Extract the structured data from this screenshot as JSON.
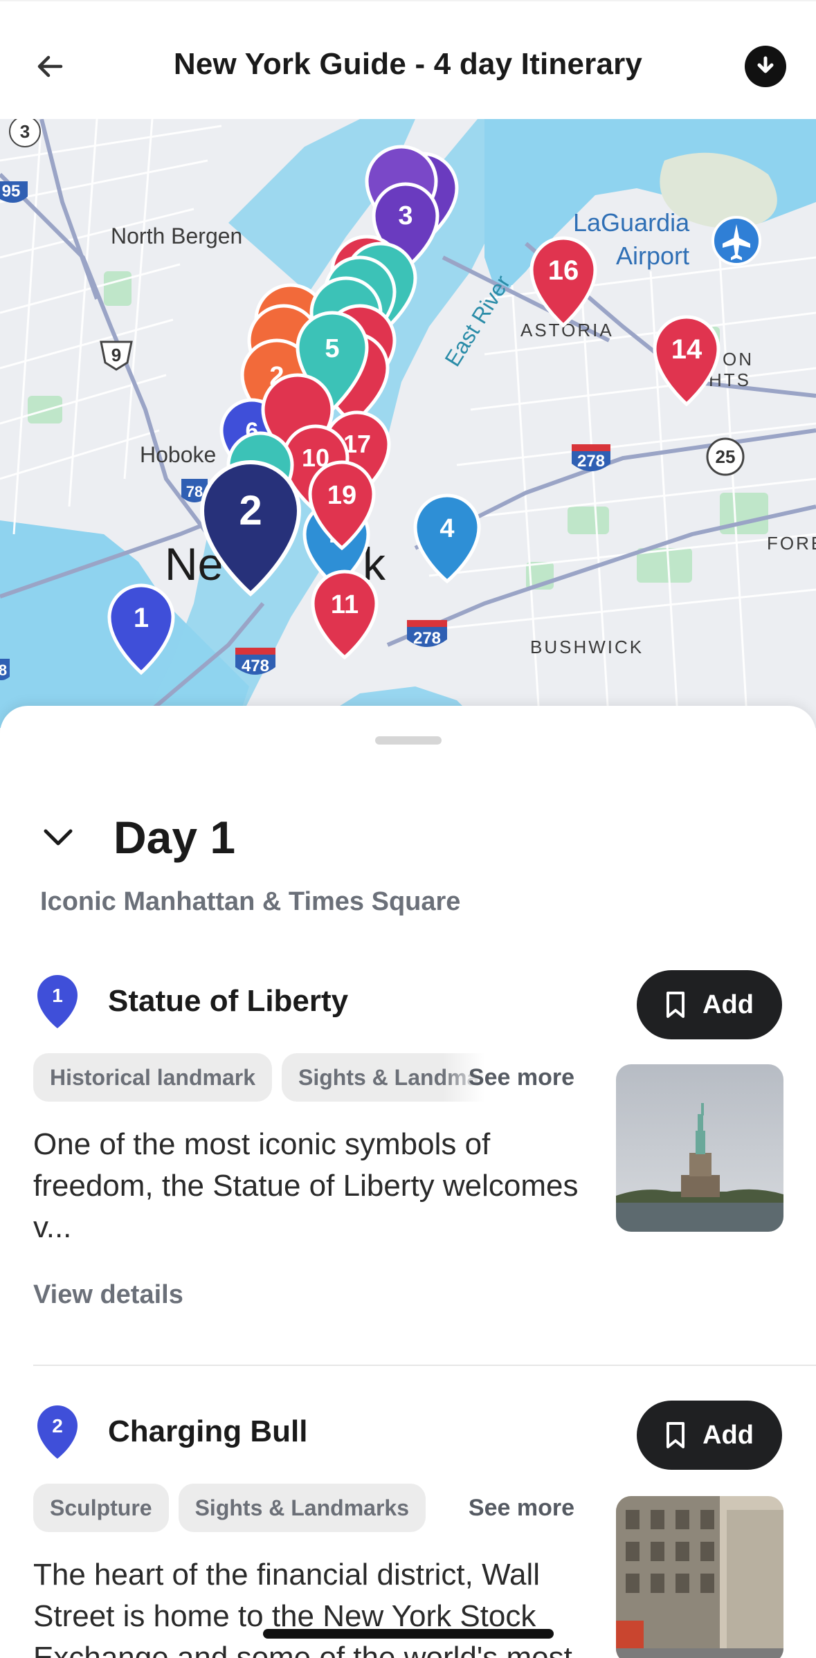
{
  "header": {
    "title": "New York Guide - 4 day Itinerary",
    "back_icon": "arrow-left-icon",
    "download_icon": "download-icon"
  },
  "map": {
    "labels": {
      "north_bergen": "North Bergen",
      "laguardia_1": "LaGuardia",
      "laguardia_2": "Airport",
      "astoria": "ASTORIA",
      "hoboken": "Hoboke",
      "east_river": "East River",
      "new_york": "Ne",
      "new_york_k": "k",
      "bushwick": "BUSHWICK",
      "fore": "FORE",
      "heights_1": "ON",
      "heights_2": "HTS"
    },
    "route_shields": [
      "3",
      "95",
      "9",
      "278",
      "25",
      "478",
      "278",
      "78",
      "8"
    ],
    "markers": [
      {
        "label": "1",
        "color": "#3f4fd9"
      },
      {
        "label": "2",
        "color": "#27317a"
      },
      {
        "label": "3",
        "color": "#6a3bbf"
      },
      {
        "label": "4",
        "color": "#2e8fd6"
      },
      {
        "label": "5",
        "color": "#3cc2b7"
      },
      {
        "label": "11",
        "color": "#e0344f"
      },
      {
        "label": "14",
        "color": "#e0344f"
      },
      {
        "label": "16",
        "color": "#e0344f"
      },
      {
        "label": "19",
        "color": "#e0344f"
      },
      {
        "label": "10",
        "color": "#e0344f"
      },
      {
        "label": "17",
        "color": "#e0344f"
      },
      {
        "label": "2",
        "color": "#2e8fd6"
      },
      {
        "label": "2",
        "color": "#f26a3a"
      },
      {
        "label": "6",
        "color": "#3f4fd9"
      }
    ],
    "airport_icon": "airplane-icon"
  },
  "day": {
    "title": "Day 1",
    "subtitle": "Iconic Manhattan & Times Square",
    "chevron_icon": "chevron-down-icon"
  },
  "places": [
    {
      "index": "1",
      "name": "Statue of Liberty",
      "add_label": "Add",
      "tags": [
        "Historical landmark",
        "Sights & Landmarks"
      ],
      "see_more": "See more",
      "description": "One of the most iconic symbols of freedom, the Statue of Liberty welcomes v...",
      "view_details": "View details"
    },
    {
      "index": "2",
      "name": "Charging Bull",
      "add_label": "Add",
      "tags": [
        "Sculpture",
        "Sights & Landmarks"
      ],
      "see_more": "See more",
      "description": "The heart of the financial district, Wall Street is home to the New York Stock Exchange and some of the world's most"
    }
  ],
  "colors": {
    "pin_blue": "#3f4fd9",
    "button_dark": "#1f2022",
    "muted_text": "#6b7079",
    "water": "#8fd3ef"
  }
}
